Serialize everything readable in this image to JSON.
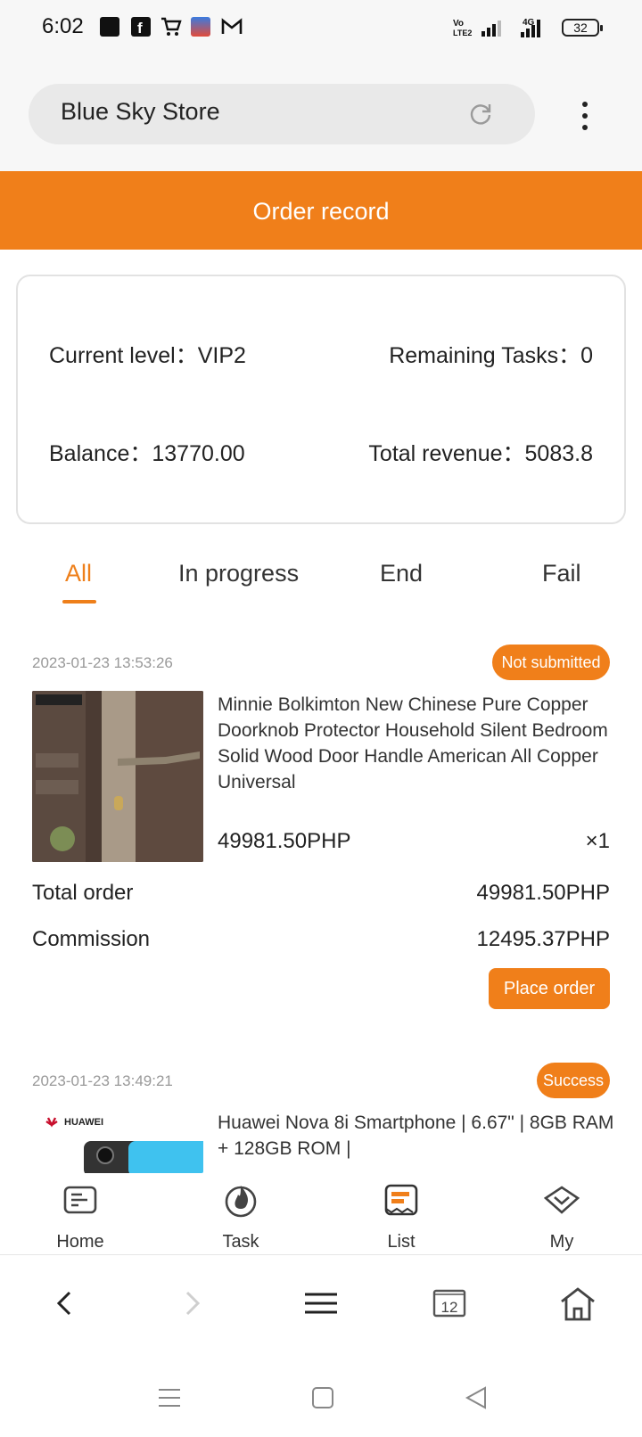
{
  "status_bar": {
    "time": "6:02",
    "battery": "32",
    "network": "4G"
  },
  "browser": {
    "site_title": "Blue Sky Store"
  },
  "header": {
    "title": "Order record"
  },
  "summary": {
    "level_label": "Current level：",
    "level_value": "VIP2",
    "tasks_label": "Remaining Tasks：",
    "tasks_value": "0",
    "balance_label": "Balance：",
    "balance_value": "13770.00",
    "revenue_label": "Total revenue：",
    "revenue_value": "5083.8"
  },
  "tabs": [
    {
      "label": "All",
      "active": true
    },
    {
      "label": "In progress",
      "active": false
    },
    {
      "label": "End",
      "active": false
    },
    {
      "label": "Fail",
      "active": false
    }
  ],
  "orders": [
    {
      "date": "2023-01-23 13:53:26",
      "status": "Not submitted",
      "name": "Minnie Bolkimton New Chinese Pure Copper Doorknob Protector Household Silent Bedroom Solid Wood Door Handle American All Copper Universal",
      "price": "49981.50PHP",
      "quantity": "×1",
      "total_label": "Total order",
      "total_value": "49981.50PHP",
      "commission_label": "Commission",
      "commission_value": "12495.37PHP",
      "action": "Place order"
    },
    {
      "date": "2023-01-23 13:49:21",
      "status": "Success",
      "name": "Huawei Nova 8i Smartphone | 6.67\" | 8GB RAM + 128GB ROM |",
      "brand": "HUAWEI"
    }
  ],
  "app_nav": [
    {
      "label": "Home",
      "icon": "home-card-icon"
    },
    {
      "label": "Task",
      "icon": "fire-icon"
    },
    {
      "label": "List",
      "icon": "list-icon"
    },
    {
      "label": "My",
      "icon": "diamond-icon"
    }
  ],
  "browser_nav": {
    "tabs_count": "12"
  },
  "colors": {
    "accent": "#f07f1a",
    "text": "#222222",
    "muted": "#999999"
  }
}
